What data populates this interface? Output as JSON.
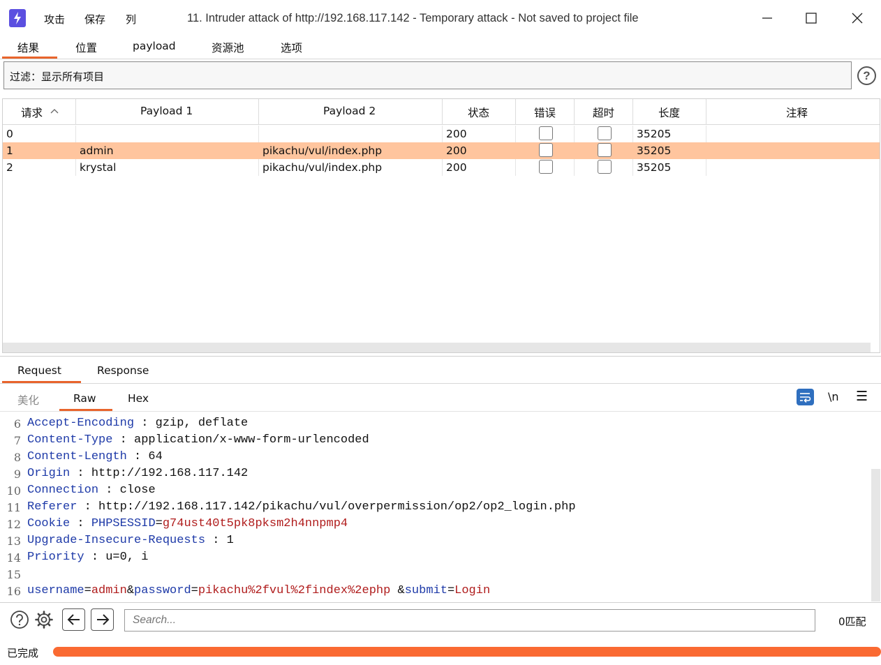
{
  "window": {
    "title": "11. Intruder attack of http://192.168.117.142 - Temporary attack - Not saved to project file",
    "menu": [
      "攻击",
      "保存",
      "列"
    ]
  },
  "tabs": [
    "结果",
    "位置",
    "payload",
    "资源池",
    "选项"
  ],
  "filter": {
    "label": "过滤：显示所有项目"
  },
  "table": {
    "columns": [
      "请求",
      "Payload 1",
      "Payload 2",
      "状态",
      "错误",
      "超时",
      "长度",
      "注释"
    ],
    "rows": [
      {
        "req": "0",
        "p1": "",
        "p2": "",
        "status": "200",
        "error": false,
        "timeout": false,
        "length": "35205",
        "comment": ""
      },
      {
        "req": "1",
        "p1": "admin",
        "p2": "pikachu/vul/index.php",
        "status": "200",
        "error": false,
        "timeout": false,
        "length": "35205",
        "comment": "",
        "selected": true
      },
      {
        "req": "2",
        "p1": "krystal",
        "p2": "pikachu/vul/index.php",
        "status": "200",
        "error": false,
        "timeout": false,
        "length": "35205",
        "comment": ""
      }
    ]
  },
  "message_tabs": [
    "Request",
    "Response"
  ],
  "view_tabs": [
    "美化",
    "Raw",
    "Hex"
  ],
  "editor_toolbar": {
    "newline_label": "\\n",
    "menu_label": "☰"
  },
  "editor": {
    "lines": [
      {
        "n": "6",
        "parts": [
          {
            "t": "Accept-Encoding",
            "c": "k"
          },
          {
            "t": " : gzip, deflate",
            "c": ""
          }
        ]
      },
      {
        "n": "7",
        "parts": [
          {
            "t": "Content-Type",
            "c": "k"
          },
          {
            "t": " : application/x-www-form-urlencoded",
            "c": ""
          }
        ]
      },
      {
        "n": "8",
        "parts": [
          {
            "t": "Content-Length",
            "c": "k"
          },
          {
            "t": " : 64",
            "c": ""
          }
        ]
      },
      {
        "n": "9",
        "parts": [
          {
            "t": "Origin",
            "c": "k"
          },
          {
            "t": " : http://192.168.117.142",
            "c": ""
          }
        ]
      },
      {
        "n": "10",
        "parts": [
          {
            "t": "Connection",
            "c": "k"
          },
          {
            "t": " : close",
            "c": ""
          }
        ]
      },
      {
        "n": "11",
        "parts": [
          {
            "t": "Referer",
            "c": "k"
          },
          {
            "t": " : http://192.168.117.142/pikachu/vul/overpermission/op2/op2_login.php",
            "c": ""
          }
        ]
      },
      {
        "n": "12",
        "parts": [
          {
            "t": "Cookie",
            "c": "k"
          },
          {
            "t": " : ",
            "c": ""
          },
          {
            "t": "PHPSESSID",
            "c": "k"
          },
          {
            "t": "=",
            "c": ""
          },
          {
            "t": "g74ust40t5pk8pksm2h4nnpmp4",
            "c": "v"
          }
        ]
      },
      {
        "n": "13",
        "parts": [
          {
            "t": "Upgrade-Insecure-Requests",
            "c": "k"
          },
          {
            "t": " : 1",
            "c": ""
          }
        ]
      },
      {
        "n": "14",
        "parts": [
          {
            "t": "Priority",
            "c": "k"
          },
          {
            "t": " : u=0, i",
            "c": ""
          }
        ]
      },
      {
        "n": "15",
        "parts": []
      },
      {
        "n": "16",
        "parts": [
          {
            "t": "username",
            "c": "k"
          },
          {
            "t": "=",
            "c": ""
          },
          {
            "t": "admin",
            "c": "v"
          },
          {
            "t": "&",
            "c": ""
          },
          {
            "t": "password",
            "c": "k"
          },
          {
            "t": "=",
            "c": ""
          },
          {
            "t": "pikachu%2fvul%2findex%2ephp",
            "c": "v"
          },
          {
            "t": " &",
            "c": ""
          },
          {
            "t": "submit",
            "c": "k"
          },
          {
            "t": "=",
            "c": ""
          },
          {
            "t": "Login",
            "c": "v"
          }
        ]
      }
    ]
  },
  "search": {
    "placeholder": "Search...",
    "match_count": "0匹配"
  },
  "status": {
    "text": "已完成",
    "progress": 1.0
  },
  "colors": {
    "accent": "#e8642c",
    "selected_row": "#ffc59e",
    "progress": "#fa6a32",
    "logo": "#5b4fe0"
  },
  "icons": [
    "burp-logo-icon",
    "minimize-icon",
    "maximize-icon",
    "close-icon",
    "help-icon",
    "sort-up-icon",
    "wrap-lines-icon",
    "gear-icon",
    "arrow-left-icon",
    "arrow-right-icon"
  ]
}
